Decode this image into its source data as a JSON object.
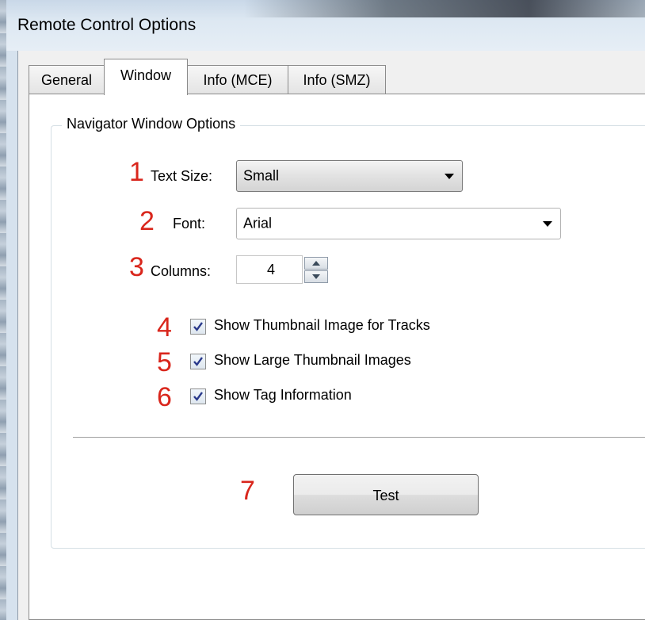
{
  "window": {
    "title": "Remote Control Options"
  },
  "tabs": [
    {
      "label": "General",
      "active": false
    },
    {
      "label": "Window",
      "active": true
    },
    {
      "label": "Info (MCE)",
      "active": false
    },
    {
      "label": "Info (SMZ)",
      "active": false
    }
  ],
  "group": {
    "title": "Navigator Window Options"
  },
  "fields": {
    "text_size": {
      "label": "Text Size:",
      "value": "Small",
      "marker": "1"
    },
    "font": {
      "label": "Font:",
      "value": "Arial",
      "marker": "2"
    },
    "columns": {
      "label": "Columns:",
      "value": "4",
      "marker": "3"
    }
  },
  "checkboxes": [
    {
      "label": "Show Thumbnail Image for Tracks",
      "checked": true,
      "marker": "4"
    },
    {
      "label": "Show Large Thumbnail Images",
      "checked": true,
      "marker": "5"
    },
    {
      "label": "Show Tag Information",
      "checked": true,
      "marker": "6"
    }
  ],
  "test_button": {
    "label": "Test",
    "marker": "7"
  },
  "icons": {
    "dropdown": "chevron-down-icon",
    "spin_up": "spin-up-icon",
    "spin_down": "spin-down-icon",
    "check": "check-icon"
  },
  "colors": {
    "marker_red": "#d9261c",
    "title_gradient": "#c9d8e8",
    "checkmark": "#2a3a8c"
  }
}
